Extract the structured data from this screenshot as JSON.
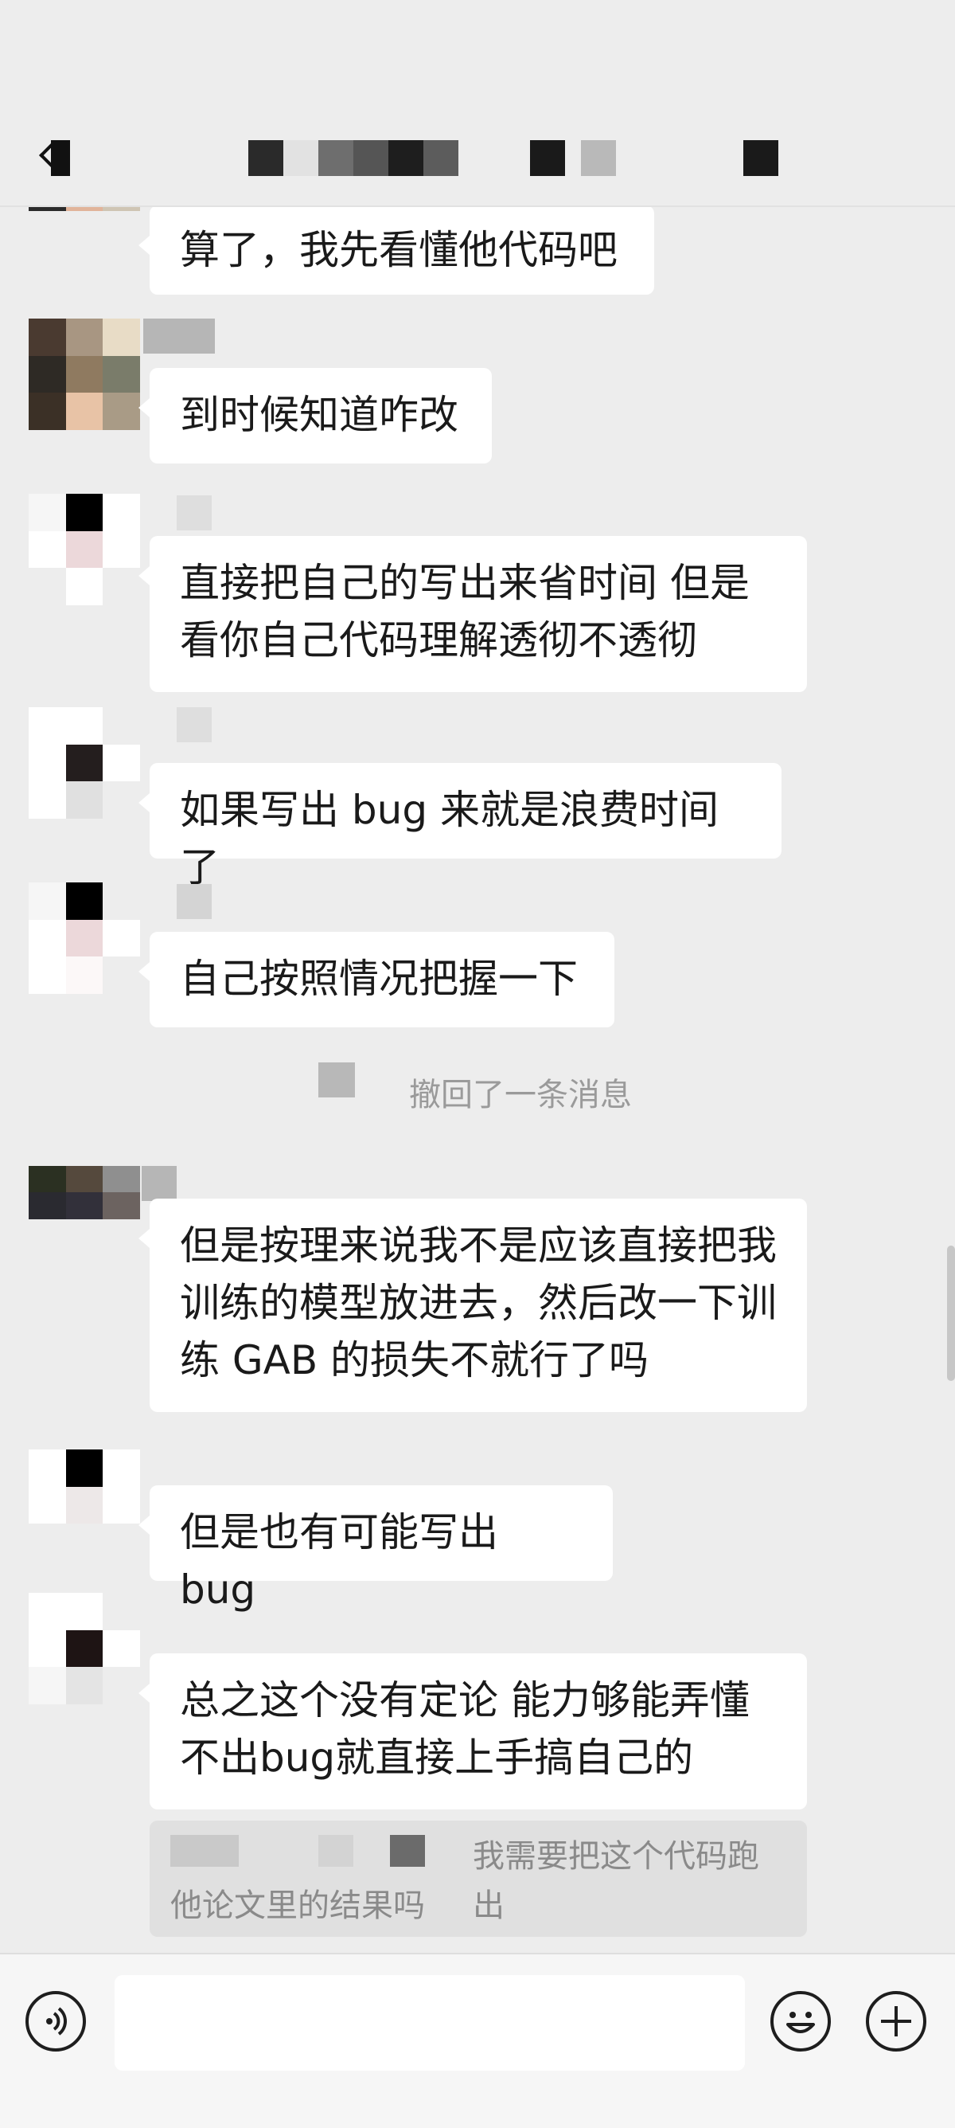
{
  "chat": {
    "messages": [
      {
        "text": "算了，我先看懂他代码吧"
      },
      {
        "text": "到时候知道咋改"
      },
      {
        "text": "直接把自己的写出来省时间 但是\n看你自己代码理解透彻不透彻"
      },
      {
        "text": "如果写出 bug 来就是浪费时间了"
      },
      {
        "text": "自己按照情况把握一下"
      },
      {
        "text": "但是按理来说我不是应该直接把我\n训练的模型放进去，然后改一下训\n练 GAB 的损失不就行了吗"
      },
      {
        "text": "但是也有可能写出 bug"
      },
      {
        "text": "总之这个没有定论 能力够能弄懂\n不出bug就直接上手搞自己的"
      }
    ],
    "system_notice": "撤回了一条消息",
    "quote": {
      "line1": "我需要把这个代码跑出",
      "line2": "他论文里的结果吗"
    }
  },
  "composer": {
    "input_value": "",
    "icons": [
      "voice-icon",
      "emoji-icon",
      "plus-icon"
    ]
  },
  "header": {
    "icons": [
      "back-icon"
    ]
  },
  "colors": {
    "background": "#ededed",
    "bubble": "#ffffff",
    "quote": "#e0e0e0",
    "system_text": "#9a9a9a"
  }
}
